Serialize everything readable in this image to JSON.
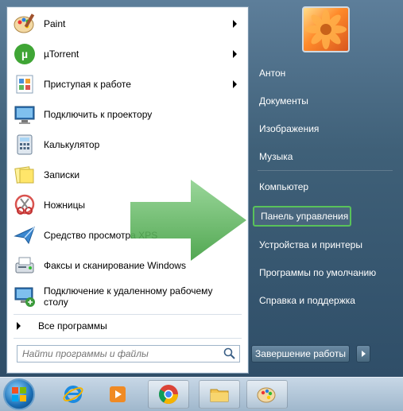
{
  "left_panel": {
    "items": [
      {
        "label": "Paint",
        "icon": "paint-palette-icon",
        "has_arrow": true
      },
      {
        "label": "µTorrent",
        "icon": "utorrent-icon",
        "has_arrow": true
      },
      {
        "label": "Приступая к работе",
        "icon": "getting-started-icon",
        "has_arrow": true
      },
      {
        "label": "Подключить к проектору",
        "icon": "projector-icon",
        "has_arrow": false
      },
      {
        "label": "Калькулятор",
        "icon": "calculator-icon",
        "has_arrow": false
      },
      {
        "label": "Записки",
        "icon": "sticky-notes-icon",
        "has_arrow": false
      },
      {
        "label": "Ножницы",
        "icon": "snipping-tool-icon",
        "has_arrow": false
      },
      {
        "label": "Средство просмотра XPS",
        "icon": "xps-viewer-icon",
        "has_arrow": false
      },
      {
        "label": "Факсы и сканирование Windows",
        "icon": "fax-scan-icon",
        "has_arrow": false
      },
      {
        "label": "Подключение к удаленному рабочему столу",
        "label_line2": "столу",
        "label_line1": "Подключение к удаленному рабочему",
        "icon": "remote-desktop-icon",
        "has_arrow": false
      }
    ],
    "all_programs": "Все программы",
    "search_placeholder": "Найти программы и файлы"
  },
  "right_panel": {
    "items": [
      {
        "label": "Антон"
      },
      {
        "label": "Документы"
      },
      {
        "label": "Изображения"
      },
      {
        "label": "Музыка"
      },
      {
        "label": "Компьютер"
      },
      {
        "label": "Панель управления",
        "highlighted": true
      },
      {
        "label": "Устройства и принтеры"
      },
      {
        "label": "Программы по умолчанию"
      },
      {
        "label": "Справка и поддержка"
      }
    ],
    "shutdown_label": "Завершение работы"
  },
  "taskbar": {
    "items": [
      "start-orb-icon",
      "internet-explorer-icon",
      "media-player-icon",
      "chrome-icon",
      "file-explorer-icon",
      "paint-palette-icon"
    ]
  },
  "colors": {
    "highlight_border": "#59c25a",
    "arrow_fill": "#5cb85c"
  }
}
